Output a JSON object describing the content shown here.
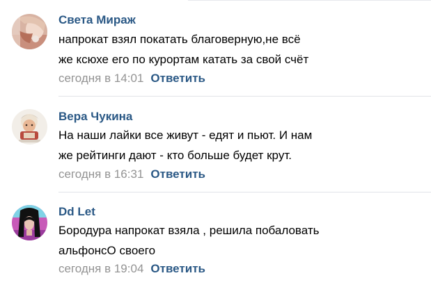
{
  "comments": [
    {
      "author": "Света Мираж",
      "text_lines": [
        "напрокат взял покатать благоверную,не всё",
        "же ксюхе его по курортам катать за свой счёт"
      ],
      "time": "сегодня в 14:01",
      "reply_label": "Ответить"
    },
    {
      "author": "Вера Чукина",
      "text_lines": [
        "На наши лайки все живут - едят и пьют. И нам",
        "же рейтинги дают - кто больше будет крут."
      ],
      "time": "сегодня в 16:31",
      "reply_label": "Ответить"
    },
    {
      "author": "Dd Let",
      "text_lines": [
        "Бородура напрокат взяла , решила побаловать",
        "альфонсО своего"
      ],
      "time": "сегодня в 19:04",
      "reply_label": "Ответить"
    }
  ],
  "colors": {
    "author": "#2a5885",
    "reply": "#2a5885",
    "time": "#939393",
    "divider": "#e1e3e8"
  }
}
